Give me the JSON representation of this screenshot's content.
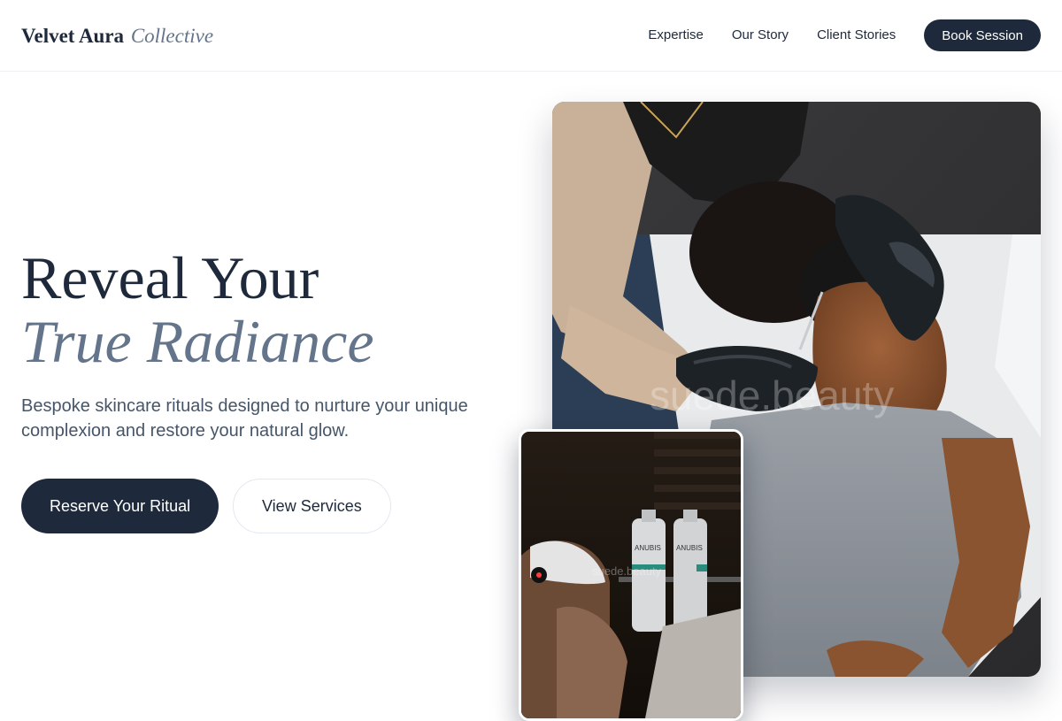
{
  "header": {
    "logo_main": "Velvet Aura",
    "logo_sub": "Collective",
    "nav": [
      {
        "label": "Expertise"
      },
      {
        "label": "Our Story"
      },
      {
        "label": "Client Stories"
      }
    ],
    "book_label": "Book Session"
  },
  "hero": {
    "title_line1": "Reveal Your",
    "title_line2": "True Radiance",
    "subtitle": "Bespoke skincare rituals designed to nurture your unique complexion and restore your natural glow.",
    "primary_cta": "Reserve Your Ritual",
    "secondary_cta": "View Services"
  },
  "images": {
    "main_watermark": "suede.beauty",
    "small_watermark": "suede.beauty",
    "bottle_label_1": "ANUBIS",
    "bottle_label_2": "ANUBIS"
  },
  "colors": {
    "navy": "#1e293b",
    "slate": "#64748b",
    "text_muted": "#475569"
  }
}
